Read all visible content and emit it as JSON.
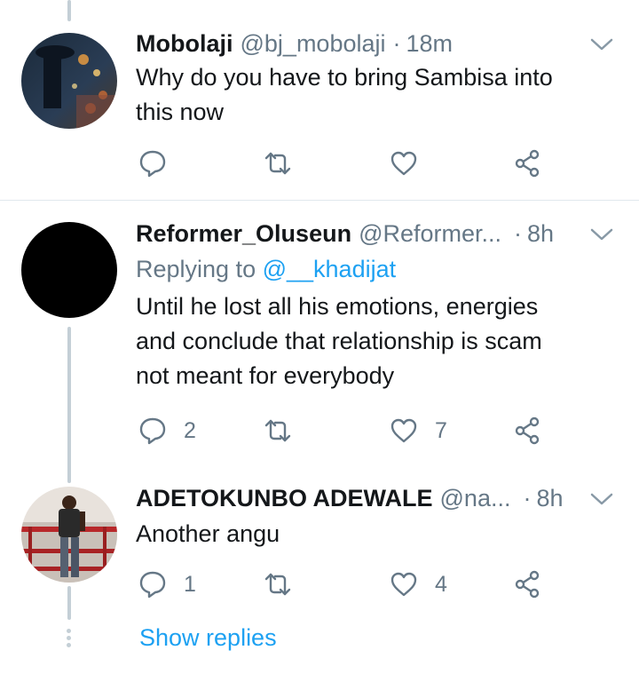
{
  "colors": {
    "accent": "#1da1f2",
    "secondary_text": "#657786",
    "thread_line": "#c4cfd6"
  },
  "tweets": [
    {
      "name": "Mobolaji",
      "handle": "@bj_mobolaji",
      "separator": "·",
      "time": "18m",
      "replying_prefix": "",
      "replying_mention": "",
      "lines": [
        "Why do you have to bring Sambisa into",
        "this now"
      ],
      "reply_count": "",
      "like_count": ""
    },
    {
      "name": "Reformer_Oluseun",
      "handle": "@Reformer...",
      "separator": "·",
      "time": "8h",
      "replying_prefix": "Replying to ",
      "replying_mention": "@__khadijat",
      "lines": [
        "Until he lost all his emotions, energies",
        "and conclude that  relationship is scam",
        "not meant for everybody"
      ],
      "reply_count": "2",
      "like_count": "7"
    },
    {
      "name": "ADETOKUNBO ADEWALE",
      "handle": "@na...",
      "separator": "·",
      "time": "8h",
      "lines": [
        "Another angu"
      ],
      "reply_count": "1",
      "like_count": "4"
    }
  ],
  "show_replies_label": "Show replies",
  "icons": [
    "reply-icon",
    "retweet-icon",
    "like-icon",
    "share-icon",
    "chevron-down-icon"
  ]
}
